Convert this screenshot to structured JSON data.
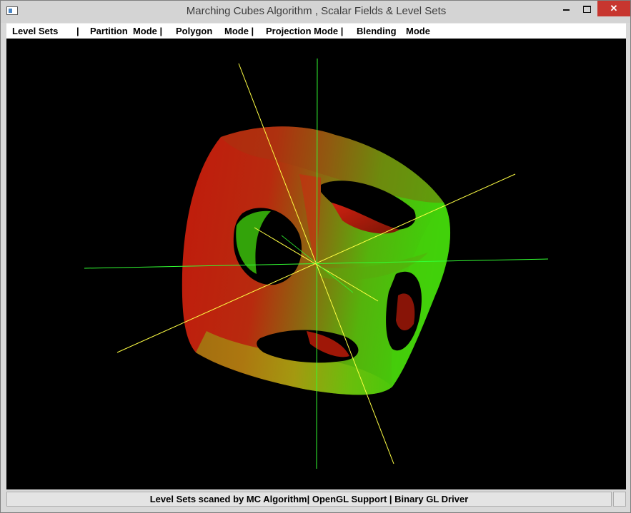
{
  "window": {
    "title": "Marching Cubes Algorithm , Scalar Fields & Level Sets",
    "controls": {
      "minimize": "minimize",
      "maximize": "maximize",
      "close": "✕"
    }
  },
  "menu": {
    "items": [
      {
        "label": "Level Sets"
      },
      {
        "label": "|"
      },
      {
        "label": "Partition  Mode |"
      },
      {
        "label": "Polygon"
      },
      {
        "label": "Mode |"
      },
      {
        "label": "Projection Mode |"
      },
      {
        "label": "Blending"
      },
      {
        "label": "Mode"
      }
    ]
  },
  "status": {
    "text": "Level Sets scaned by MC Algorithm| OpenGL Support | Binary GL Driver"
  },
  "colors": {
    "surface_red": "#c41f0d",
    "surface_green": "#3cc90a",
    "axis_yellow": "#ffff40",
    "axis_green": "#3cff3c",
    "background": "#000000"
  }
}
